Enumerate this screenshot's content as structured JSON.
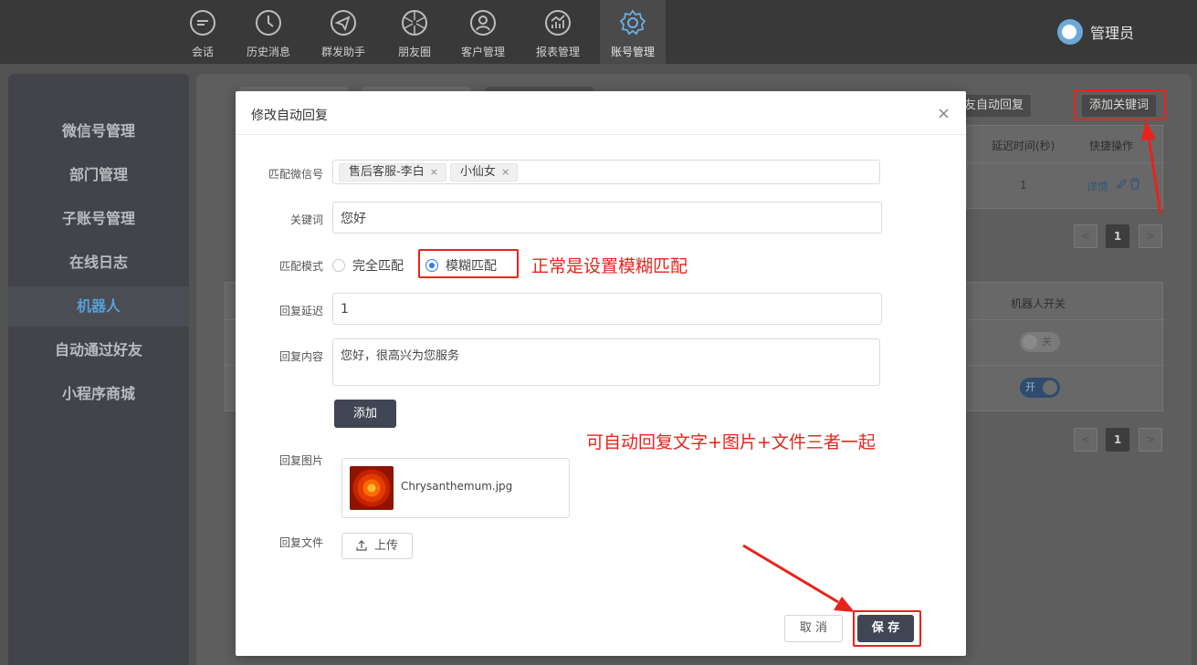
{
  "nav": {
    "items": [
      {
        "label": "会话",
        "icon": "chat-icon"
      },
      {
        "label": "历史消息",
        "icon": "clock-icon"
      },
      {
        "label": "群发助手",
        "icon": "send-icon"
      },
      {
        "label": "朋友圈",
        "icon": "aperture-icon"
      },
      {
        "label": "客户管理",
        "icon": "person-icon"
      },
      {
        "label": "报表管理",
        "icon": "chart-icon"
      },
      {
        "label": "账号管理",
        "icon": "gear-icon"
      }
    ],
    "active_index": 6,
    "user_name": "管理员"
  },
  "sidebar": {
    "items": [
      "微信号管理",
      "部门管理",
      "子账号管理",
      "在线日志",
      "机器人",
      "自动通过好友",
      "小程序商城"
    ],
    "active_index": 4
  },
  "background": {
    "tab_partial_label": "友自动回复",
    "add_keyword_label": "添加关键词",
    "table1": {
      "headers": [
        "延迟时间(秒)",
        "快捷操作"
      ],
      "row_delay": "1",
      "row_detail_link": "详情"
    },
    "table2": {
      "header": "机器人开关",
      "toggle_off_label": "关",
      "toggle_on_label": "开"
    },
    "page_current": "1",
    "page_prev": "<",
    "page_next": ">"
  },
  "modal": {
    "title": "修改自动回复",
    "close": "×",
    "fields": {
      "wechat_label": "匹配微信号",
      "wechat_tags": [
        "售后客服-李白",
        "小仙女"
      ],
      "keyword_label": "关键词",
      "keyword_value": "您好",
      "mode_label": "匹配模式",
      "mode_exact": "完全匹配",
      "mode_fuzzy": "模糊匹配",
      "mode_selected": "模糊匹配",
      "delay_label": "回复延迟",
      "delay_value": "1",
      "content_label": "回复内容",
      "content_value": "您好，很高兴为您服务",
      "add_label": "添加",
      "image_label": "回复图片",
      "image_file": "Chrysanthemum.jpg",
      "file_label": "回复文件",
      "upload_label": "上传"
    },
    "cancel_label": "取 消",
    "save_label": "保 存"
  },
  "annotations": {
    "fuzzy_note": "正常是设置模糊匹配",
    "combo_note": "可自动回复文字+图片+文件三者一起"
  },
  "colors": {
    "annotation_red": "#e8231c",
    "accent_blue": "#2e7de2",
    "button_dark": "#414655"
  }
}
